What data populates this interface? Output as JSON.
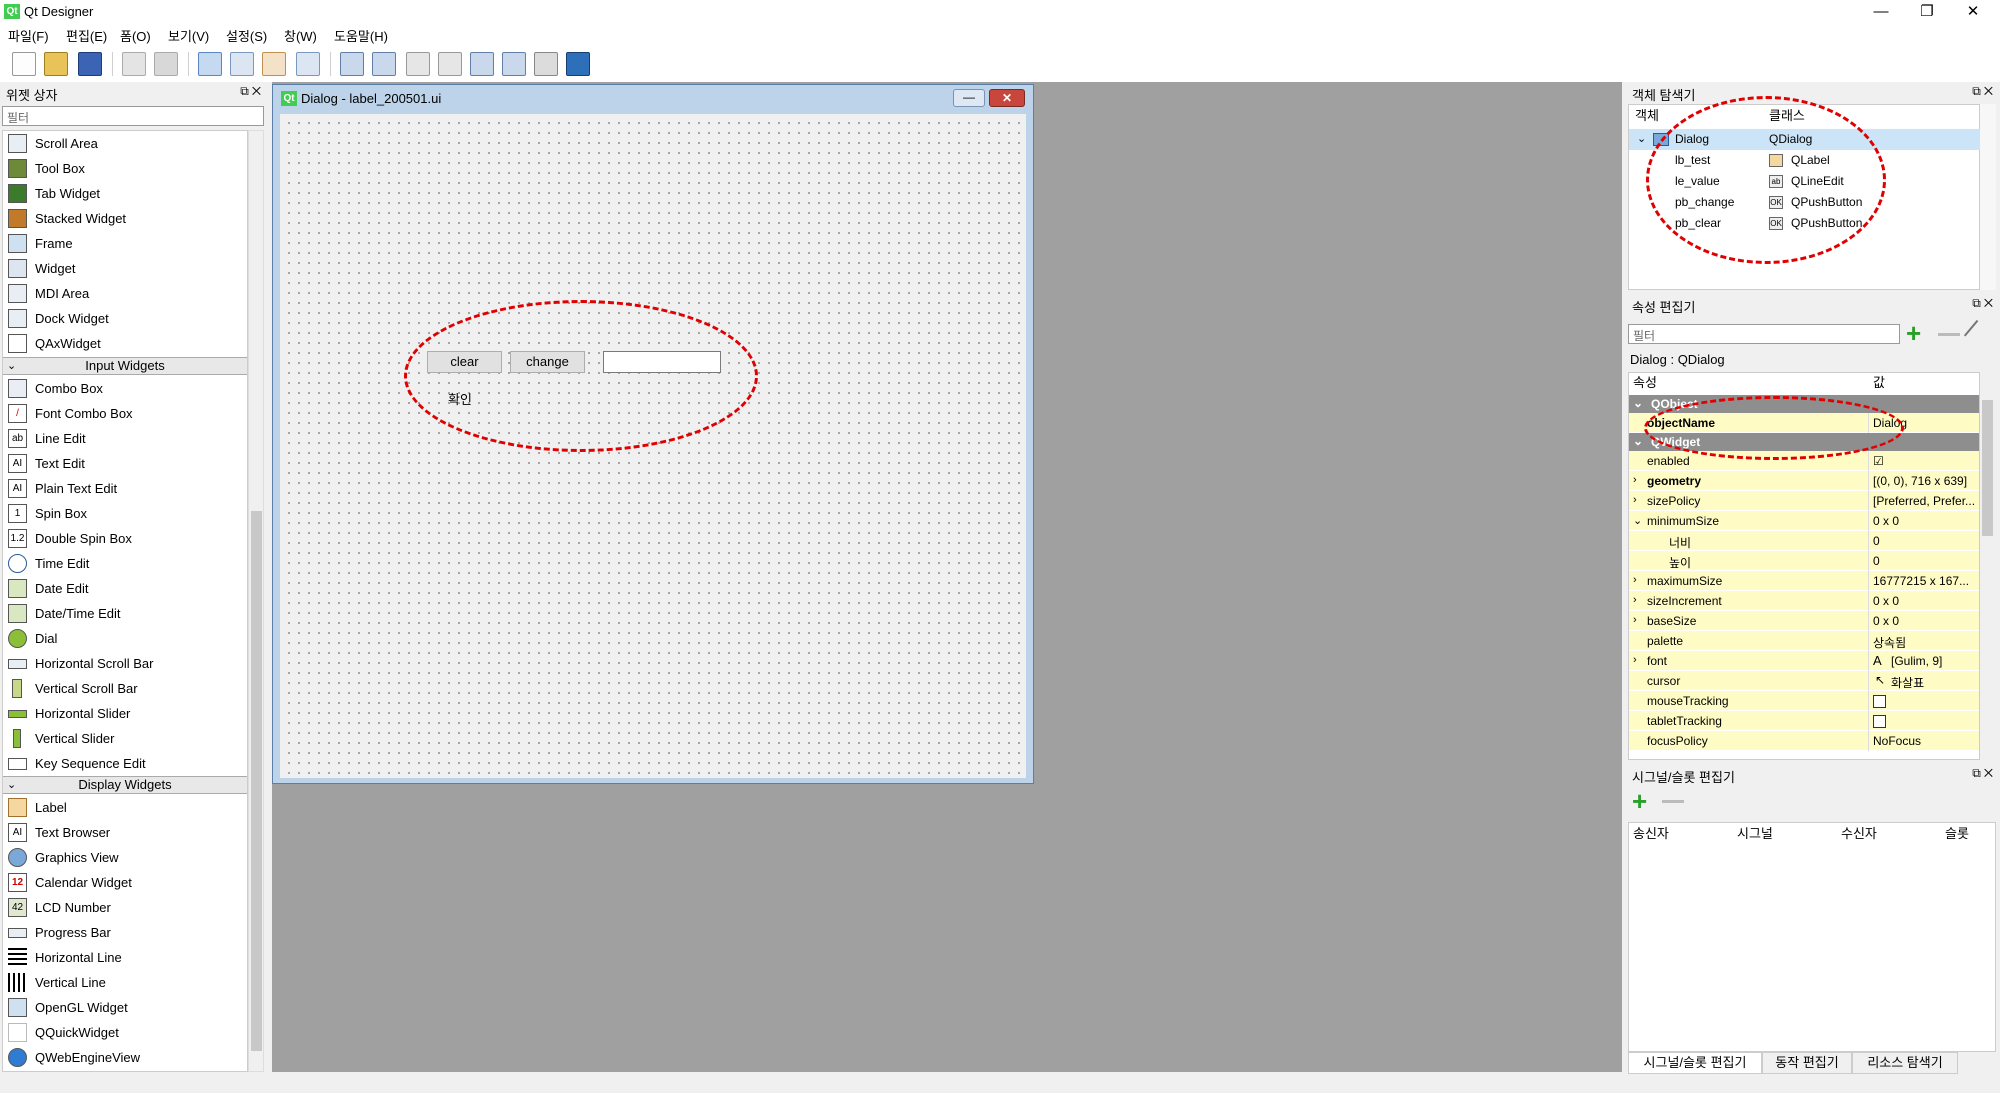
{
  "app": {
    "title": "Qt Designer",
    "logo_text": "Qt"
  },
  "window_controls": {
    "minimize": "—",
    "maximize": "❐",
    "close": "✕"
  },
  "menu": [
    "파일(F)",
    "편집(E)",
    "폼(O)",
    "보기(V)",
    "설정(S)",
    "창(W)",
    "도움말(H)"
  ],
  "widget_box": {
    "title": "위젯 상자",
    "filter_placeholder": "필터",
    "items_top": [
      "Scroll Area",
      "Tool Box",
      "Tab Widget",
      "Stacked Widget",
      "Frame",
      "Widget",
      "MDI Area",
      "Dock Widget",
      "QAxWidget"
    ],
    "cat_input": "Input Widgets",
    "items_input": [
      "Combo Box",
      "Font Combo Box",
      "Line Edit",
      "Text Edit",
      "Plain Text Edit",
      "Spin Box",
      "Double Spin Box",
      "Time Edit",
      "Date Edit",
      "Date/Time Edit",
      "Dial",
      "Horizontal Scroll Bar",
      "Vertical Scroll Bar",
      "Horizontal Slider",
      "Vertical Slider",
      "Key Sequence Edit"
    ],
    "cat_display": "Display Widgets",
    "items_display": [
      "Label",
      "Text Browser",
      "Graphics View",
      "Calendar Widget",
      "LCD Number",
      "Progress Bar",
      "Horizontal Line",
      "Vertical Line",
      "OpenGL Widget",
      "QQuickWidget",
      "QWebEngineView"
    ]
  },
  "dialog": {
    "title": "Dialog - label_200501.ui",
    "clear_label": "clear",
    "change_label": "change",
    "line_edit_value": "",
    "label_text": "확인"
  },
  "object_inspector": {
    "title": "객체 탐색기",
    "col_object": "객체",
    "col_class": "클래스",
    "rows": [
      {
        "object": "Dialog",
        "class": "QDialog"
      },
      {
        "object": "lb_test",
        "class": "QLabel"
      },
      {
        "object": "le_value",
        "class": "QLineEdit"
      },
      {
        "object": "pb_change",
        "class": "QPushButton"
      },
      {
        "object": "pb_clear",
        "class": "QPushButton"
      }
    ]
  },
  "property_editor": {
    "title": "속성 편집기",
    "filter_placeholder": "필터",
    "class_line": "Dialog : QDialog",
    "col_property": "속성",
    "col_value": "값",
    "group_qobject": "QObject",
    "group_qwidget": "QWidget",
    "props": {
      "objectName": {
        "name": "objectName",
        "value": "Dialog"
      },
      "enabled": {
        "name": "enabled",
        "value": "☑"
      },
      "geometry": {
        "name": "geometry",
        "value": "[(0, 0), 716 x 639]"
      },
      "sizePolicy": {
        "name": "sizePolicy",
        "value": "[Preferred, Prefer..."
      },
      "minimumSize": {
        "name": "minimumSize",
        "value": "0 x 0"
      },
      "min_width": {
        "name": "너비",
        "value": "0"
      },
      "min_height": {
        "name": "높이",
        "value": "0"
      },
      "maximumSize": {
        "name": "maximumSize",
        "value": "16777215 x 167..."
      },
      "sizeIncrement": {
        "name": "sizeIncrement",
        "value": "0 x 0"
      },
      "baseSize": {
        "name": "baseSize",
        "value": "0 x 0"
      },
      "palette": {
        "name": "palette",
        "value": "상속됨"
      },
      "font": {
        "name": "font",
        "value": "[Gulim, 9]"
      },
      "cursor": {
        "name": "cursor",
        "value": "화살표"
      },
      "mouseTracking": {
        "name": "mouseTracking",
        "value": ""
      },
      "tabletTracking": {
        "name": "tabletTracking",
        "value": ""
      },
      "focusPolicy": {
        "name": "focusPolicy",
        "value": "NoFocus"
      }
    }
  },
  "signal_slot": {
    "title": "시그널/슬롯 편집기",
    "cols": [
      "송신자",
      "시그널",
      "수신자",
      "슬롯"
    ]
  },
  "bottom_tabs": [
    "시그널/슬롯 편집기",
    "동작 편집기",
    "리소스 탐색기"
  ],
  "colors": {
    "annotation": "#e00000",
    "qt_green": "#41cd52",
    "property_row": "#fffbc5"
  }
}
